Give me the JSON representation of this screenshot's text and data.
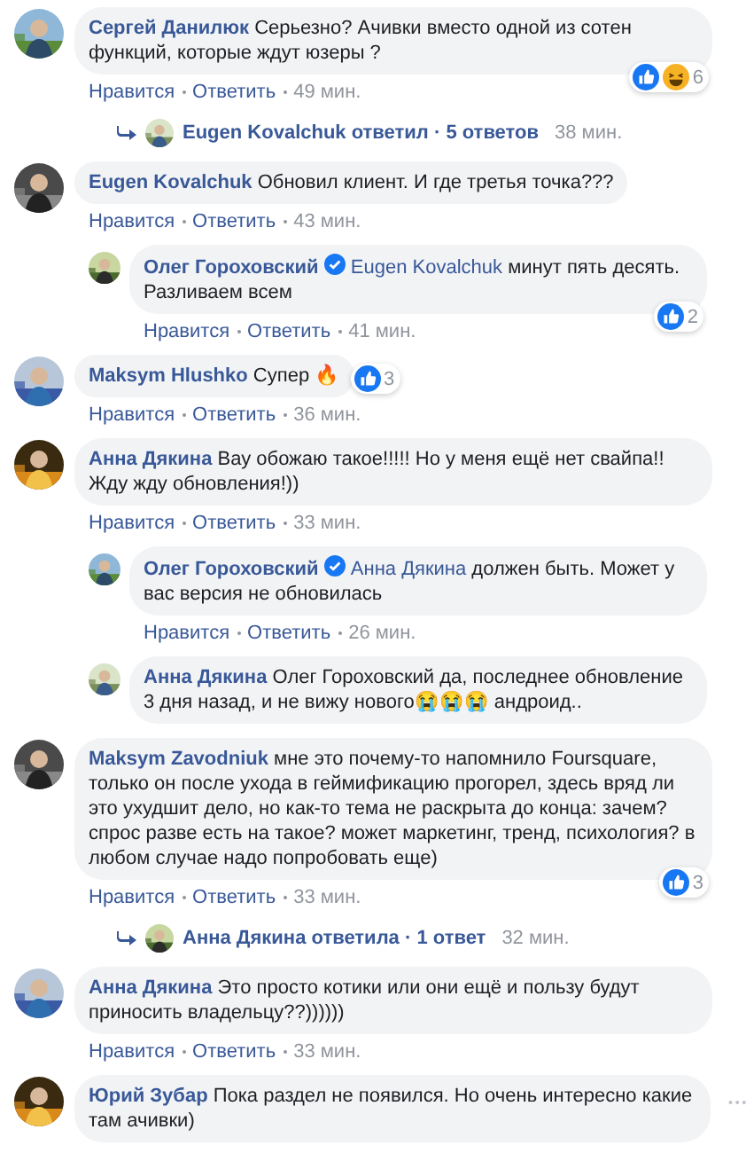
{
  "comments": [
    {
      "kind": "comment",
      "nested": false,
      "author": "Сергей Данилюк",
      "verified": false,
      "text": "Серьезно? Ачивки вместо одной из сотен функций, которые ждут юзеры ?",
      "reactions": {
        "like": true,
        "haha": true,
        "count": "6",
        "side": false
      },
      "actions": {
        "like": "Нравится",
        "reply": "Ответить",
        "time": "49 мин."
      }
    },
    {
      "kind": "replies",
      "text": "Eugen Kovalchuk ответил · 5 ответов",
      "time": "38 мин."
    },
    {
      "kind": "comment",
      "nested": false,
      "author": "Eugen Kovalchuk",
      "verified": false,
      "text": "Обновил клиент. И где третья точка???",
      "actions": {
        "like": "Нравится",
        "reply": "Ответить",
        "time": "43 мин."
      }
    },
    {
      "kind": "comment",
      "nested": true,
      "author": "Олег Гороховский",
      "verified": true,
      "mention": "Eugen Kovalchuk",
      "text": "минут пять десять. Разливаем всем",
      "reactions": {
        "like": true,
        "haha": false,
        "count": "2",
        "side": false
      },
      "actions": {
        "like": "Нравится",
        "reply": "Ответить",
        "time": "41 мин."
      }
    },
    {
      "kind": "comment",
      "nested": false,
      "author": "Maksym Hlushko",
      "verified": false,
      "text": "Супер 🔥",
      "reactions": {
        "like": true,
        "haha": false,
        "count": "3",
        "side": true
      },
      "actions": {
        "like": "Нравится",
        "reply": "Ответить",
        "time": "36 мин."
      }
    },
    {
      "kind": "comment",
      "nested": false,
      "author": "Анна Дякина",
      "verified": false,
      "text": "Вау обожаю такое!!!!! Но у меня ещё нет свайпа!! Жду жду обновления!))",
      "actions": {
        "like": "Нравится",
        "reply": "Ответить",
        "time": "33 мин."
      }
    },
    {
      "kind": "comment",
      "nested": true,
      "author": "Олег Гороховский",
      "verified": true,
      "mention": "Анна Дякина",
      "text": "должен быть. Может у вас версия не обновилась",
      "actions": {
        "like": "Нравится",
        "reply": "Ответить",
        "time": "26 мин."
      }
    },
    {
      "kind": "comment",
      "nested": true,
      "author": "Анна Дякина",
      "verified": false,
      "text": "Олег Гороховский да, последнее обновление 3 дня назад, и не вижу нового😭😭😭 андроид.."
    },
    {
      "kind": "comment",
      "nested": false,
      "author": "Maksym Zavodniuk",
      "verified": false,
      "text": "мне это почему-то напомнило Foursquare, только он после ухода в геймификацию прогорел, здесь вряд ли это ухудшит дело, но как-то тема не раскрыта до конца: зачем? спрос разве есть на такое? может маркетинг, тренд, психология? в любом случае надо попробовать еще)",
      "reactions": {
        "like": true,
        "haha": false,
        "count": "3",
        "side": false
      },
      "actions": {
        "like": "Нравится",
        "reply": "Ответить",
        "time": "33 мин."
      }
    },
    {
      "kind": "replies",
      "text": "Анна Дякина ответила · 1 ответ",
      "time": "32 мин."
    },
    {
      "kind": "comment",
      "nested": false,
      "author": "Анна Дякина",
      "verified": false,
      "text": "Это просто котики или они ещё и пользу будут приносить владельцу??))))))",
      "actions": {
        "like": "Нравится",
        "reply": "Ответить",
        "time": "33 мин."
      }
    },
    {
      "kind": "comment",
      "nested": false,
      "author": "Юрий Зубар",
      "verified": false,
      "text": "Пока раздел не появился. Но очень интересно какие там ачивки)",
      "menu": true
    }
  ]
}
